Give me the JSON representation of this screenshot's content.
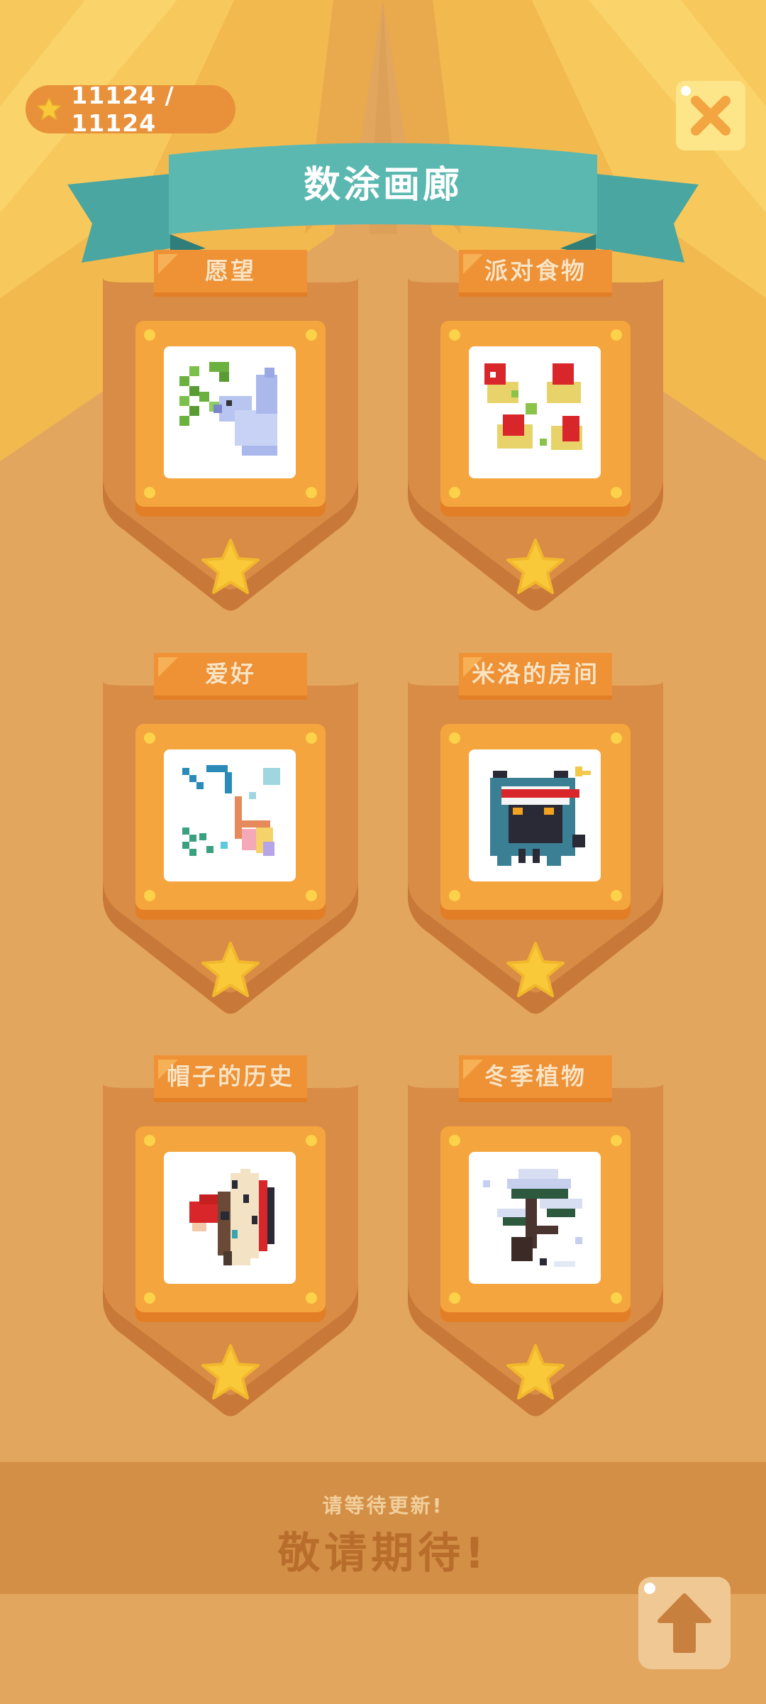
{
  "header": {
    "stars_text": "11124 / 11124",
    "title": "数涂画廊"
  },
  "collections": [
    {
      "label": "愿望",
      "art": "dove-with-branch"
    },
    {
      "label": "派对食物",
      "art": "party-food"
    },
    {
      "label": "爱好",
      "art": "fishing-rod"
    },
    {
      "label": "米洛的房间",
      "art": "cat-with-cap"
    },
    {
      "label": "帽子的历史",
      "art": "feather-headdress"
    },
    {
      "label": "冬季植物",
      "art": "snowy-pine"
    }
  ],
  "footer": {
    "subtitle": "请等待更新!",
    "message": "敬请期待!"
  },
  "icons": {
    "star": "star-icon",
    "close": "close-icon",
    "up": "arrow-up-icon"
  },
  "colors": {
    "background": "#e3a65e",
    "banner": "#5bb8b1",
    "tag": "#ef9236",
    "star": "#f9c93a"
  }
}
